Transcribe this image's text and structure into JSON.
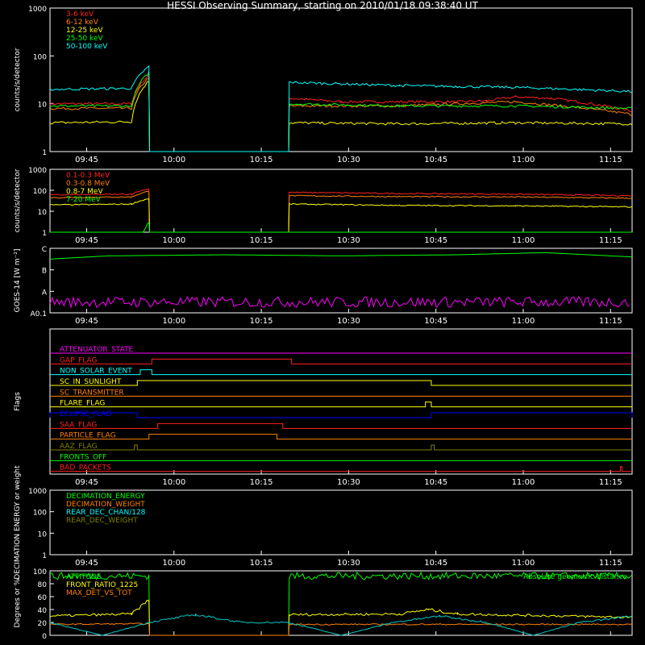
{
  "page": {
    "title": "HESSI Observing Summary, starting on 2010/01/18 09:38:40 UT"
  },
  "chart_data": [
    {
      "id": "rate_low",
      "type": "line",
      "ylabel": "counts/s/detector",
      "ylog": true,
      "ylim": [
        1,
        1000
      ],
      "yticks": [
        "1",
        "10",
        "100",
        "1000"
      ],
      "x_ticks": [
        "09:45",
        "10:00",
        "10:15",
        "10:30",
        "10:45",
        "11:00",
        "11:15"
      ],
      "x_range_minutes": [
        0,
        100
      ],
      "legend": "top-left",
      "series": [
        {
          "name": "3-6 keV",
          "color": "#ff2020",
          "gaps": [
            [
              17,
              41
            ]
          ],
          "points": [
            [
              0,
              10
            ],
            [
              14,
              10
            ],
            [
              17,
              40
            ],
            [
              17.1,
              1
            ],
            [
              41,
              1
            ],
            [
              41.1,
              13
            ],
            [
              50,
              11
            ],
            [
              60,
              11
            ],
            [
              70,
              11
            ],
            [
              75,
              11.5
            ],
            [
              80,
              14
            ],
            [
              86,
              13
            ],
            [
              100,
              7
            ]
          ]
        },
        {
          "name": "6-12 keV",
          "color": "#ff8000",
          "gaps": [
            [
              17,
              41
            ]
          ],
          "points": [
            [
              0,
              8
            ],
            [
              14,
              8
            ],
            [
              17,
              35
            ],
            [
              17.1,
              1
            ],
            [
              41,
              1
            ],
            [
              41.1,
              9
            ],
            [
              60,
              9
            ],
            [
              80,
              11
            ],
            [
              100,
              6
            ]
          ]
        },
        {
          "name": "12-25 keV",
          "color": "#ffff00",
          "gaps": [
            [
              17,
              41
            ]
          ],
          "points": [
            [
              0,
              4
            ],
            [
              14,
              4.2
            ],
            [
              17,
              30
            ],
            [
              17.1,
              1
            ],
            [
              41,
              1
            ],
            [
              41.1,
              4
            ],
            [
              60,
              3.8
            ],
            [
              80,
              4
            ],
            [
              100,
              3.8
            ]
          ]
        },
        {
          "name": "25-50 keV",
          "color": "#00ff00",
          "gaps": [
            [
              17,
              41
            ]
          ],
          "points": [
            [
              0,
              9
            ],
            [
              14,
              9
            ],
            [
              17,
              45
            ],
            [
              17.1,
              1
            ],
            [
              41,
              1
            ],
            [
              41.1,
              10
            ],
            [
              60,
              9
            ],
            [
              80,
              9
            ],
            [
              100,
              8
            ]
          ]
        },
        {
          "name": "50-100 keV",
          "color": "#00ffff",
          "gaps": [
            [
              17,
              41
            ]
          ],
          "points": [
            [
              0,
              20
            ],
            [
              14,
              21
            ],
            [
              17,
              60
            ],
            [
              17.1,
              1
            ],
            [
              41,
              1
            ],
            [
              41.1,
              28
            ],
            [
              60,
              24
            ],
            [
              80,
              22
            ],
            [
              100,
              18
            ]
          ]
        }
      ]
    },
    {
      "id": "rate_high",
      "type": "line",
      "ylabel": "counts/s/detector",
      "ylog": true,
      "ylim": [
        1,
        1000
      ],
      "yticks": [
        "1",
        "10",
        "100",
        "1000"
      ],
      "x_ticks": [
        "09:45",
        "10:00",
        "10:15",
        "10:30",
        "10:45",
        "11:00",
        "11:15"
      ],
      "x_range_minutes": [
        0,
        100
      ],
      "legend": "top-left",
      "series": [
        {
          "name": "0.1-0.3 MeV",
          "color": "#ff2020",
          "points": [
            [
              0,
              60
            ],
            [
              14,
              65
            ],
            [
              17,
              120
            ],
            [
              17.1,
              1
            ],
            [
              41,
              1
            ],
            [
              41.1,
              80
            ],
            [
              60,
              70
            ],
            [
              80,
              65
            ],
            [
              100,
              55
            ]
          ]
        },
        {
          "name": "0.3-0.8 MeV",
          "color": "#ff8000",
          "points": [
            [
              0,
              45
            ],
            [
              14,
              48
            ],
            [
              17,
              90
            ],
            [
              17.1,
              1
            ],
            [
              41,
              1
            ],
            [
              41.1,
              55
            ],
            [
              60,
              50
            ],
            [
              80,
              48
            ],
            [
              100,
              42
            ]
          ]
        },
        {
          "name": "0.8-7 MeV",
          "color": "#ffff00",
          "points": [
            [
              0,
              20
            ],
            [
              14,
              22
            ],
            [
              17,
              40
            ],
            [
              17.1,
              1
            ],
            [
              41,
              1
            ],
            [
              41.1,
              22
            ],
            [
              60,
              19
            ],
            [
              80,
              18
            ],
            [
              100,
              16
            ]
          ]
        },
        {
          "name": "7-20 MeV",
          "color": "#00ff00",
          "points": [
            [
              0,
              1
            ],
            [
              16,
              1
            ],
            [
              16.5,
              1.8
            ],
            [
              17,
              3
            ],
            [
              17.1,
              1
            ],
            [
              100,
              1
            ]
          ]
        }
      ]
    },
    {
      "id": "goes",
      "type": "line",
      "ylabel": "GOES-14 [W m⁻²]",
      "yticks": [
        "A0.1",
        "A",
        "B",
        "C"
      ],
      "x_ticks": [
        "09:45",
        "10:00",
        "10:15",
        "10:30",
        "10:45",
        "11:00",
        "11:15"
      ],
      "x_range_minutes": [
        0,
        100
      ],
      "series": [
        {
          "name": "",
          "color": "#00ff00",
          "points": [
            [
              0,
              2.5
            ],
            [
              10,
              2.65
            ],
            [
              30,
              2.7
            ],
            [
              50,
              2.65
            ],
            [
              70,
              2.7
            ],
            [
              85,
              2.8
            ],
            [
              100,
              2.6
            ]
          ]
        },
        {
          "name": "",
          "color": "#ff00ff",
          "noisy": true,
          "points": [
            [
              0,
              0.5
            ],
            [
              100,
              0.5
            ]
          ]
        }
      ]
    },
    {
      "id": "flags",
      "type": "line",
      "ylabel": "Flags",
      "x_ticks": [
        "09:45",
        "10:00",
        "10:15",
        "10:30",
        "10:45",
        "11:00",
        "11:15"
      ],
      "x_range_minutes": [
        0,
        100
      ],
      "flags": [
        {
          "name": "ATTENUATOR_STATE",
          "color": "#ff00ff",
          "high": []
        },
        {
          "name": "GAP_FLAG",
          "color": "#ff2020",
          "high": [
            [
              17.5,
              41.5
            ]
          ]
        },
        {
          "name": "NON_SOLAR_EVENT",
          "color": "#00ffff",
          "high": [
            [
              15.5,
              17.5
            ]
          ]
        },
        {
          "name": "SC_IN_SUNLIGHT",
          "color": "#ffff00",
          "high": [
            [
              15,
              65.5
            ]
          ]
        },
        {
          "name": "SC_TRANSMITTER",
          "color": "#ff8000",
          "high": []
        },
        {
          "name": "FLARE_FLAG",
          "color": "#ffff00",
          "high": [
            [
              64.5,
              65.5
            ]
          ]
        },
        {
          "name": "ECLIPSE_FLAG",
          "color": "#0000ff",
          "high": [
            [
              0,
              15
            ],
            [
              65.5,
              100
            ]
          ]
        },
        {
          "name": "SAA_FLAG",
          "color": "#ff2020",
          "high": [
            [
              18.5,
              40
            ]
          ]
        },
        {
          "name": "PARTICLE_FLAG",
          "color": "#ff8000",
          "high": [
            [
              17,
              39
            ]
          ]
        },
        {
          "name": "AAZ_FLAG",
          "color": "#808000",
          "high": [
            [
              14.5,
              15
            ],
            [
              65.5,
              66
            ]
          ]
        },
        {
          "name": "FRONTS_OFF",
          "color": "#00ff00",
          "high": []
        },
        {
          "name": "BAD_PACKETS",
          "color": "#ff2020",
          "high": [
            [
              98,
              98.3
            ]
          ]
        }
      ]
    },
    {
      "id": "decimation",
      "type": "line",
      "ylabel": "DECIMATION ENERGY or weight",
      "ylog": true,
      "ylim": [
        1,
        1000
      ],
      "yticks": [
        "1",
        "10",
        "100",
        "1000"
      ],
      "x_ticks": [
        "09:45",
        "10:00",
        "10:15",
        "10:30",
        "10:45",
        "11:00",
        "11:15"
      ],
      "x_range_minutes": [
        0,
        100
      ],
      "legend": "top-left",
      "series": [
        {
          "name": "DECIMATION_ENERGY",
          "color": "#00ff00",
          "points": []
        },
        {
          "name": "DECIMATION_WEIGHT",
          "color": "#ff8000",
          "points": []
        },
        {
          "name": "REAR_DEC_CHAN/128",
          "color": "#00ffff",
          "points": []
        },
        {
          "name": "REAR_DEC_WEIGHT",
          "color": "#808000",
          "points": []
        }
      ]
    },
    {
      "id": "angles",
      "type": "line",
      "ylabel": "Degrees or %",
      "ylim": [
        0,
        100
      ],
      "yticks": [
        "0",
        "20",
        "40",
        "60",
        "80",
        "100"
      ],
      "x_range_minutes": [
        0,
        100
      ],
      "legend": "top-left",
      "series": [
        {
          "name": "ATTITUDE",
          "color": "#00ff00",
          "points": [
            [
              0,
              92
            ],
            [
              17,
              92
            ],
            [
              17.1,
              0
            ],
            [
              41,
              0
            ],
            [
              41.1,
              92
            ],
            [
              100,
              92
            ]
          ]
        },
        {
          "name": "FRONT_RATIO_1225",
          "color": "#ffff00",
          "points": [
            [
              0,
              30
            ],
            [
              14,
              33
            ],
            [
              17,
              55
            ],
            [
              17.1,
              0
            ],
            [
              41,
              0
            ],
            [
              41.1,
              32
            ],
            [
              60,
              33
            ],
            [
              65,
              40
            ],
            [
              70,
              33
            ],
            [
              100,
              28
            ]
          ]
        },
        {
          "name": "MAX_DET_VS_TOT",
          "color": "#ff8000",
          "points": [
            [
              0,
              17
            ],
            [
              17,
              18
            ],
            [
              17.1,
              0
            ],
            [
              41,
              0
            ],
            [
              41.1,
              17
            ],
            [
              100,
              17
            ]
          ]
        },
        {
          "name": "",
          "color": "#00c8c8",
          "points": [
            [
              0,
              20
            ],
            [
              9,
              0
            ],
            [
              17,
              20
            ],
            [
              25,
              32
            ],
            [
              33,
              20
            ],
            [
              41,
              20
            ],
            [
              50,
              0
            ],
            [
              59,
              20
            ],
            [
              67,
              30
            ],
            [
              75,
              20
            ],
            [
              83,
              0
            ],
            [
              91,
              20
            ],
            [
              100,
              30
            ]
          ]
        }
      ],
      "annotation": "Absolute geometric distance"
    }
  ]
}
